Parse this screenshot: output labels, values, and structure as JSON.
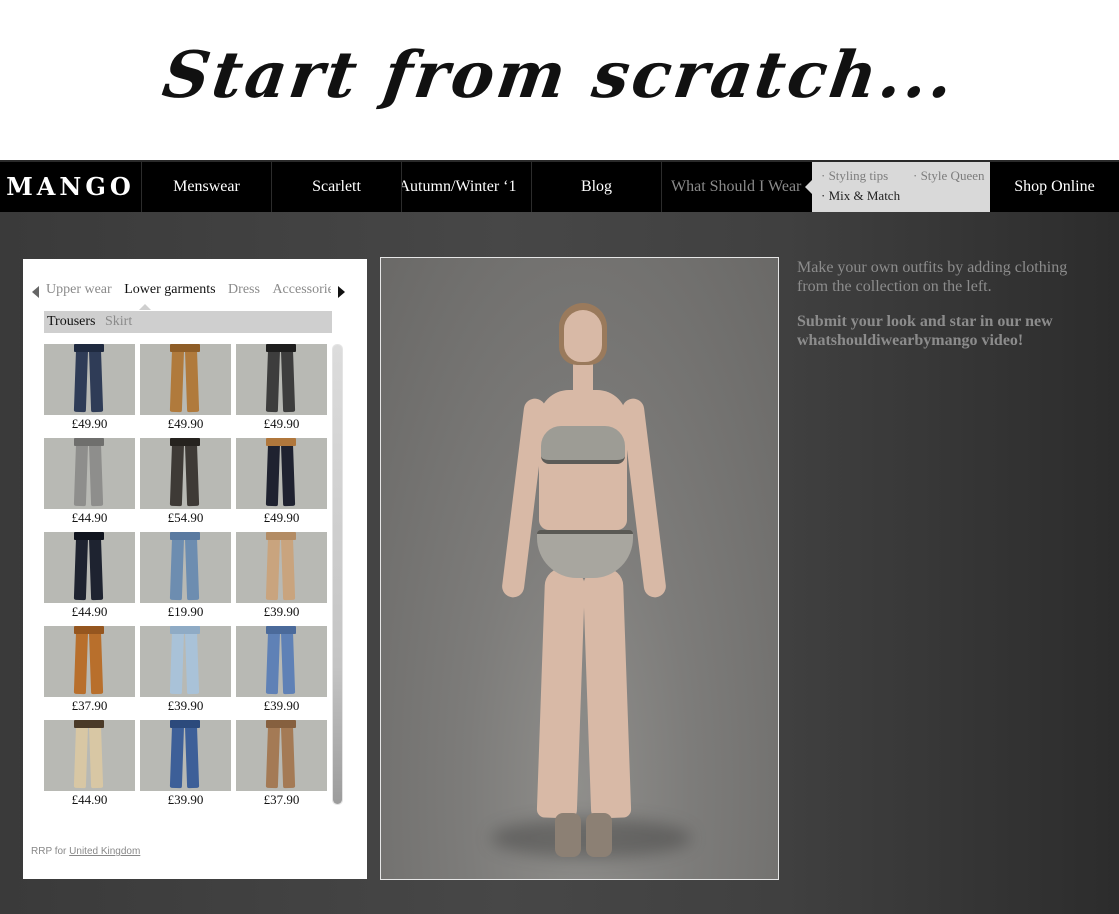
{
  "hero": {
    "title": "Start from scratch..."
  },
  "nav": {
    "logo": "MANGO",
    "items": [
      {
        "label": "Menswear"
      },
      {
        "label": "Scarlett"
      },
      {
        "label": "Autumn/Winter ‘1"
      },
      {
        "label": "Blog"
      },
      {
        "label": "What Should I Wear"
      }
    ],
    "submenu": {
      "styling_tips": "· Styling tips",
      "style_queen": "· Style Queen",
      "mix_match": "· Mix & Match"
    },
    "shop_online": "Shop Online"
  },
  "panel": {
    "categories": [
      {
        "label": "Upper wear",
        "active": false
      },
      {
        "label": "Lower garments",
        "active": true
      },
      {
        "label": "Dress",
        "active": false
      },
      {
        "label": "Accessories",
        "active": false
      }
    ],
    "subcategories": [
      {
        "label": "Trousers",
        "active": true
      },
      {
        "label": "Skirt",
        "active": false
      }
    ],
    "products": [
      {
        "price": "£49.90",
        "color": "#2f3c57",
        "waist": "#1f2a40"
      },
      {
        "price": "£49.90",
        "color": "#b07a3c",
        "waist": "#8f5e28"
      },
      {
        "price": "£49.90",
        "color": "#3d3d3d",
        "waist": "#1e1e1e"
      },
      {
        "price": "£44.90",
        "color": "#8e8e8c",
        "waist": "#6f6f6d"
      },
      {
        "price": "£54.90",
        "color": "#3e3a36",
        "waist": "#26231f"
      },
      {
        "price": "£49.90",
        "color": "#1f2230",
        "waist": "#b0773c"
      },
      {
        "price": "£44.90",
        "color": "#1e2330",
        "waist": "#11151f"
      },
      {
        "price": "£19.90",
        "color": "#6d8db0",
        "waist": "#5a7aa0"
      },
      {
        "price": "£39.90",
        "color": "#c9a47e",
        "waist": "#b38c64"
      },
      {
        "price": "£37.90",
        "color": "#b86f2c",
        "waist": "#95561f"
      },
      {
        "price": "£39.90",
        "color": "#a9c2d8",
        "waist": "#8fabc5"
      },
      {
        "price": "£39.90",
        "color": "#5f81b6",
        "waist": "#4b6a9a"
      },
      {
        "price": "£44.90",
        "color": "#d8c7a4",
        "waist": "#4a3a28"
      },
      {
        "price": "£39.90",
        "color": "#3d5f98",
        "waist": "#2c4a7c"
      },
      {
        "price": "£37.90",
        "color": "#a47a55",
        "waist": "#86603f"
      }
    ],
    "rrp_prefix": "RRP for",
    "rrp_country": "United Kingdom"
  },
  "info": {
    "line1": "Make your own outfits by adding clothing from the collection on the left.",
    "line2": "Submit your look and star in our new whatshouldiwearbymango video!"
  }
}
